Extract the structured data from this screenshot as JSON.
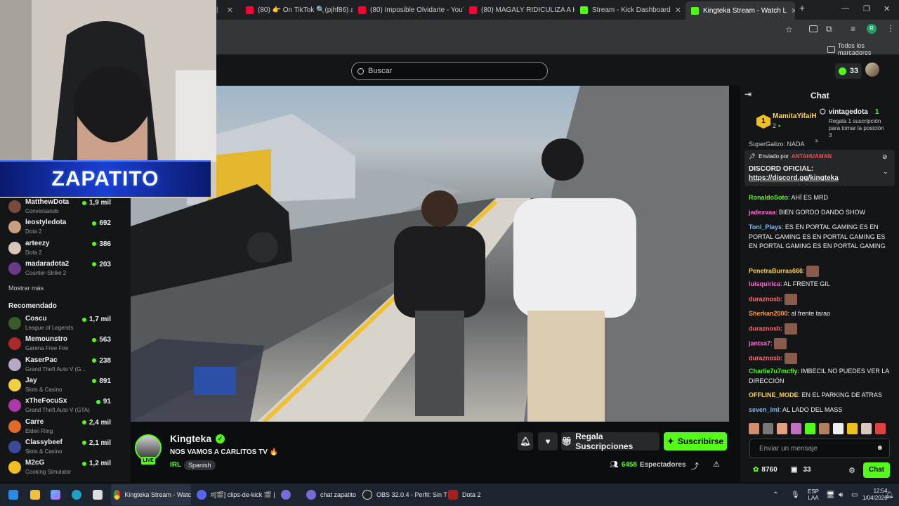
{
  "browser": {
    "tabs": [
      {
        "label": "(80) 👉 On TikTok 🔍(pjhf86) a",
        "icon": "youtube-icon"
      },
      {
        "label": "(80) Imposible Olvidarte - YouT",
        "icon": "youtube-icon"
      },
      {
        "label": "(80) MAGALY RIDICULIZA A KIN",
        "icon": "youtube-icon"
      },
      {
        "label": "Stream - Kick Dashboard",
        "icon": "kick-icon"
      },
      {
        "label": "Kingteka Stream - Watch L",
        "icon": "kick-icon"
      }
    ],
    "bookmarks_label": "Todos los marcadores"
  },
  "header": {
    "search_placeholder": "Buscar",
    "kicks_count": "33"
  },
  "overlay": {
    "name": "ZAPATITO"
  },
  "sidebar": {
    "following": [
      {
        "name": "MatthewDota",
        "game": "Conversando",
        "viewers": "1,9 mil",
        "color": "#7a4a3a"
      },
      {
        "name": "leostyledota",
        "game": "Dota 2",
        "viewers": "692",
        "color": "#c8a080"
      },
      {
        "name": "arteezy",
        "game": "Dota 2",
        "viewers": "386",
        "color": "#d9c8b8"
      },
      {
        "name": "madaradota2",
        "game": "Counter-Strike 2",
        "viewers": "203",
        "color": "#6a3a8a"
      }
    ],
    "show_more": "Mostrar más",
    "recommended_title": "Recomendado",
    "recommended": [
      {
        "name": "Coscu",
        "game": "League of Legends",
        "viewers": "1,7 mil",
        "color": "#3a5a2a"
      },
      {
        "name": "Memounstro",
        "game": "Garena Free Fire",
        "viewers": "563",
        "color": "#aa2a2a"
      },
      {
        "name": "KaserPac",
        "game": "Grand Theft Auto V (G...",
        "viewers": "238",
        "color": "#b8a8c8"
      },
      {
        "name": "Jay",
        "game": "Slots & Casino",
        "viewers": "891",
        "color": "#f0d040"
      },
      {
        "name": "xTheFocuSx",
        "game": "Grand Theft Auto V (GTA)",
        "viewers": "91",
        "color": "#aa3aaa"
      },
      {
        "name": "Carre",
        "game": "Elden Ring",
        "viewers": "2,4 mil",
        "color": "#e06a2a"
      },
      {
        "name": "Classybeef",
        "game": "Slots & Casino",
        "viewers": "2,1 mil",
        "color": "#3a4a9a"
      },
      {
        "name": "M2cG",
        "game": "Cooking Simulator",
        "viewers": "1,2 mil",
        "color": "#f0c020"
      }
    ]
  },
  "stream": {
    "channel": "Kingteka",
    "live_badge": "LIVE",
    "title": "NOS VAMOS A CARLITOS TV 🔥",
    "category": "IRL",
    "language": "Spanish",
    "gift_label": "Regala Suscripciones",
    "subscribe_label": "Suscribirse",
    "viewers": "6458",
    "viewers_label": "Espectadores"
  },
  "chat": {
    "title": "Chat",
    "top_gifter_rank": "1",
    "top_gifter_name": "MamitaYifaiH",
    "top_gifter_count": "2",
    "second_name": "vintagedota",
    "second_count": "1",
    "second_note": "Regala 1 suscripción para tomar la posición 3",
    "cut_line": "SuperGalizo: NADA",
    "pinned_by": "Enviado por",
    "pinned_user": "ANTAHUAMAN",
    "pinned_title": "DISCORD OFICIAL:",
    "pinned_link": "https://discord.gg/kingteka",
    "messages": [
      {
        "user": "RonaldoSoto",
        "color": "#53fc18",
        "text": "AHÍ ES MRD"
      },
      {
        "user": "jadexvaa",
        "color": "#ff6ad5",
        "text": "BIEN GORDO DANDO SHOW"
      },
      {
        "user": "Toni_Plays",
        "color": "#7ab8ff",
        "text": "ES EN PORTAL GAMING ES EN PORTAL GAMING ES EN PORTAL GAMING ES EN PORTAL GAMING ES EN PORTAL GAMING"
      },
      {
        "user": "PenetraBurras666",
        "color": "#ffd24a",
        "text": ""
      },
      {
        "user": "luisquirica",
        "color": "#ff6ad5",
        "text": "AL FRENTE GIL"
      },
      {
        "user": "duraznosb",
        "color": "#ff6a6a",
        "text": ""
      },
      {
        "user": "Sherkan2000",
        "color": "#ff9a3a",
        "text": "al frente tarao"
      },
      {
        "user": "duraznosb",
        "color": "#ff6a6a",
        "text": ""
      },
      {
        "user": "jantsa7",
        "color": "#ff6ad5",
        "text": ""
      },
      {
        "user": "duraznosb",
        "color": "#ff6a6a",
        "text": ""
      },
      {
        "user": "Charlie7u7mcfly",
        "color": "#53fc18",
        "text": "IMBECIL NO PUEDES VER LA DIRECCIÓN"
      },
      {
        "user": "OFFLINE_MODE",
        "color": "#ffd24a",
        "text": "EN EL PARKING DE ATRAS"
      },
      {
        "user": "seven_lml",
        "color": "#7ab8ff",
        "text": "AL LADO DEL MASS"
      }
    ],
    "input_placeholder": "Enviar un mensaje",
    "points": "8760",
    "gift_count": "33",
    "send_label": "Chat"
  },
  "taskbar": {
    "items": [
      "Kingteka Stream - Watc",
      "#[🎬] clips-de-kick 🎬 |",
      "chat zapatito",
      "OBS 32.0.4 - Perfil: Sin T",
      "Dota 2"
    ],
    "lang": "ESP",
    "lang2": "LAA",
    "time": "12:54",
    "date": "1/04/2026"
  }
}
